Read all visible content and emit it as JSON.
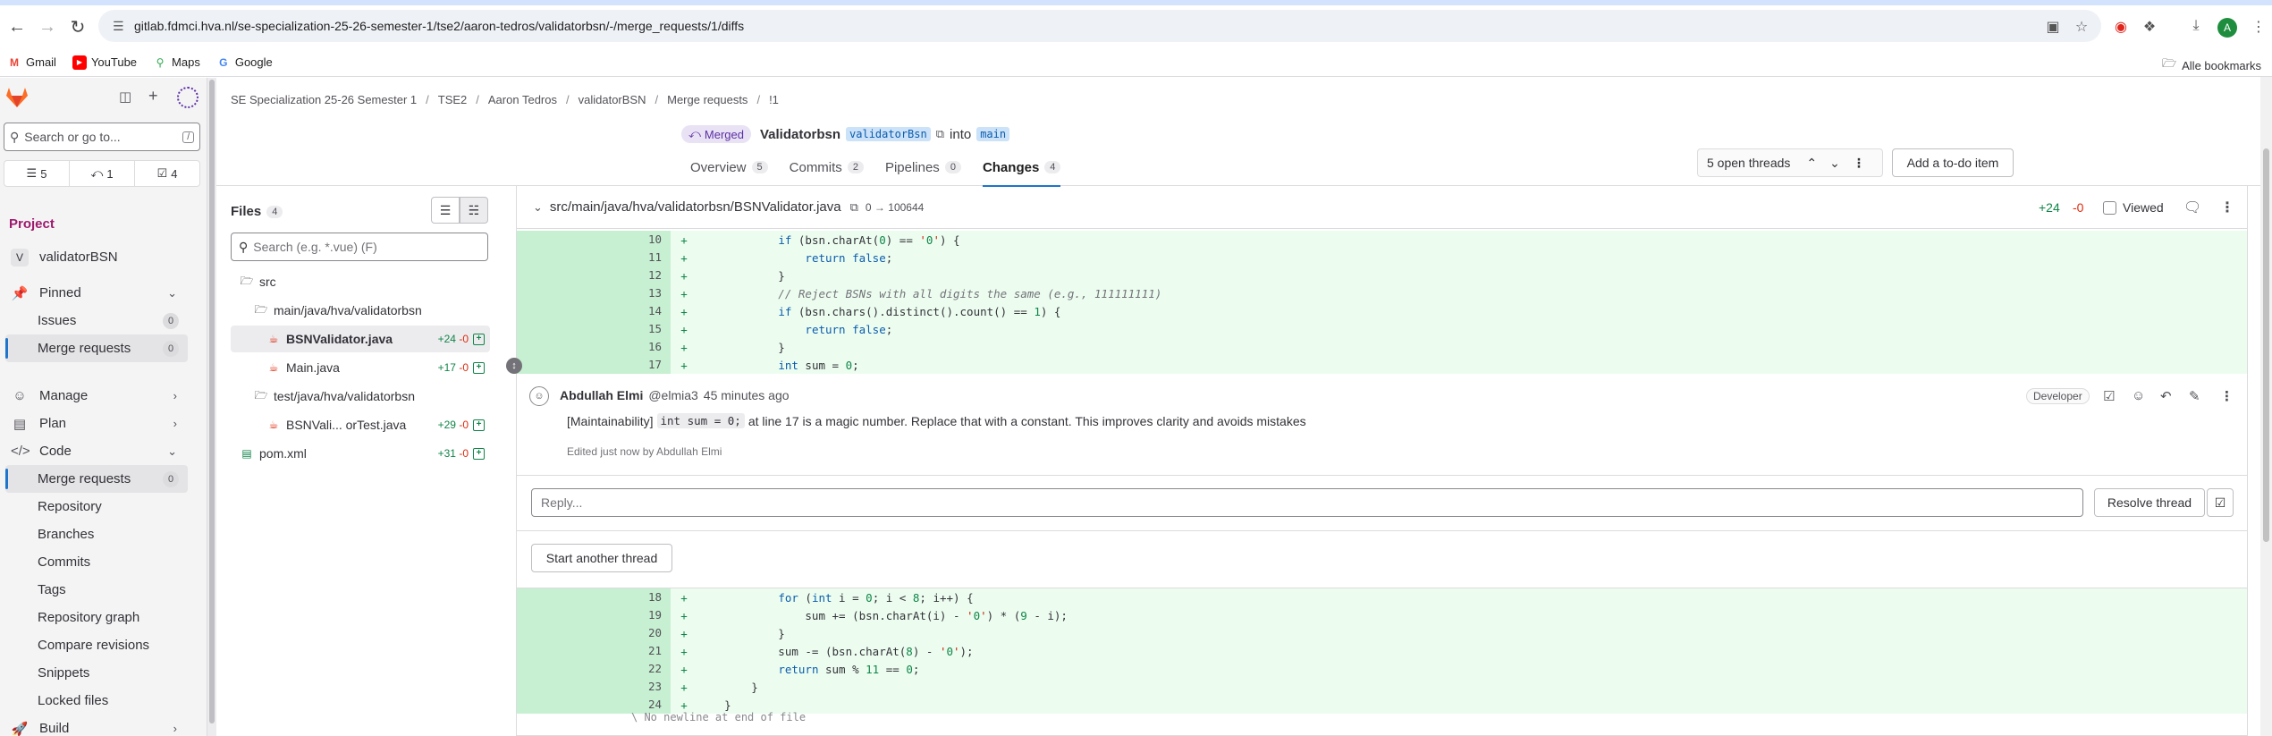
{
  "browser": {
    "url": "gitlab.fdmci.hva.nl/se-specialization-25-26-semester-1/tse2/aaron-tedros/validatorbsn/-/merge_requests/1/diffs",
    "bookmarks": [
      {
        "label": "Gmail",
        "icon": "gmail-icon"
      },
      {
        "label": "YouTube",
        "icon": "youtube-icon"
      },
      {
        "label": "Maps",
        "icon": "maps-icon"
      },
      {
        "label": "Google",
        "icon": "google-icon"
      }
    ],
    "all_bookmarks": "Alle bookmarks",
    "profile_initial": "A"
  },
  "sidebar": {
    "search_placeholder": "Search or go to...",
    "search_shortcut": "/",
    "counters": [
      {
        "icon": "issues-icon",
        "value": "5"
      },
      {
        "icon": "merge-request-icon",
        "value": "1"
      },
      {
        "icon": "todo-icon",
        "value": "4"
      }
    ],
    "context_label": "Project",
    "project_initial": "V",
    "project_name": "validatorBSN",
    "pinned_label": "Pinned",
    "pinned_items": [
      {
        "label": "Issues",
        "count": "0"
      },
      {
        "label": "Merge requests",
        "count": "0"
      }
    ],
    "sections": [
      {
        "label": "Manage",
        "icon": "users-icon"
      },
      {
        "label": "Plan",
        "icon": "planning-icon"
      },
      {
        "label": "Code",
        "icon": "code-icon"
      }
    ],
    "code_items": [
      {
        "label": "Merge requests",
        "count": "0"
      },
      {
        "label": "Repository"
      },
      {
        "label": "Branches"
      },
      {
        "label": "Commits"
      },
      {
        "label": "Tags"
      },
      {
        "label": "Repository graph"
      },
      {
        "label": "Compare revisions"
      },
      {
        "label": "Snippets"
      },
      {
        "label": "Locked files"
      }
    ],
    "build_label": "Build"
  },
  "breadcrumb": [
    "SE Specialization 25-26 Semester 1",
    "TSE2",
    "Aaron Tedros",
    "validatorBSN",
    "Merge requests",
    "!1"
  ],
  "mr": {
    "status": "Merged",
    "title": "Validatorbsn",
    "source_branch": "validatorBsn",
    "into": "into",
    "target_branch": "main",
    "tabs": [
      {
        "label": "Overview",
        "count": "5"
      },
      {
        "label": "Commits",
        "count": "2"
      },
      {
        "label": "Pipelines",
        "count": "0"
      },
      {
        "label": "Changes",
        "count": "4"
      }
    ],
    "open_threads": "5 open threads",
    "todo_button": "Add a to-do item"
  },
  "files": {
    "title": "Files",
    "count": "4",
    "search_placeholder": "Search (e.g. *.vue) (F)",
    "tree": [
      {
        "label": "src",
        "type": "folder",
        "indent": 1
      },
      {
        "label": "main/java/hva/validatorbsn",
        "type": "folder",
        "indent": 2
      },
      {
        "label": "BSNValidator.java",
        "type": "java",
        "indent": 3,
        "added": "+24",
        "removed": "-0",
        "active": true
      },
      {
        "label": "Main.java",
        "type": "java",
        "indent": 3,
        "added": "+17",
        "removed": "-0"
      },
      {
        "label": "test/java/hva/validatorbsn",
        "type": "folder",
        "indent": 2
      },
      {
        "label": "BSNVali... orTest.java",
        "type": "java",
        "indent": 3,
        "added": "+29",
        "removed": "-0"
      },
      {
        "label": "pom.xml",
        "type": "xml",
        "indent": 1,
        "added": "+31",
        "removed": "-0"
      }
    ]
  },
  "diff": {
    "file_path": "src/main/java/hva/validatorbsn/BSNValidator.java",
    "mode": "0 → 100644",
    "added": "+24",
    "removed": "-0",
    "viewed_label": "Viewed",
    "lines_top": [
      {
        "n": "10",
        "code": "            if (bsn.charAt(0) == '0') {"
      },
      {
        "n": "11",
        "code": "                return false;"
      },
      {
        "n": "12",
        "code": "            }"
      },
      {
        "n": "13",
        "code": "            // Reject BSNs with all digits the same (e.g., 111111111)"
      },
      {
        "n": "14",
        "code": "            if (bsn.chars().distinct().count() == 1) {"
      },
      {
        "n": "15",
        "code": "                return false;"
      },
      {
        "n": "16",
        "code": "            }"
      },
      {
        "n": "17",
        "code": "            int sum = 0;"
      }
    ],
    "lines_bottom": [
      {
        "n": "18",
        "code": "            for (int i = 0; i < 8; i++) {"
      },
      {
        "n": "19",
        "code": "                sum += (bsn.charAt(i) - '0') * (9 - i);"
      },
      {
        "n": "20",
        "code": "            }"
      },
      {
        "n": "21",
        "code": "            sum -= (bsn.charAt(8) - '0');"
      },
      {
        "n": "22",
        "code": "            return sum % 11 == 0;"
      },
      {
        "n": "23",
        "code": "        }"
      },
      {
        "n": "24",
        "code": "    }"
      }
    ],
    "no_newline": "\\ No newline at end of file"
  },
  "note": {
    "author": "Abdullah Elmi",
    "handle": "@elmia3",
    "time": "45 minutes ago",
    "role": "Developer",
    "tag": "[Maintainability]",
    "code": "int sum = 0;",
    "text": "at line 17 is a magic number. Replace that with a constant. This improves clarity and avoids mistakes",
    "edited": "Edited just now by Abdullah Elmi",
    "reply_placeholder": "Reply...",
    "resolve_label": "Resolve thread",
    "start_thread_label": "Start another thread"
  },
  "colors": {
    "accent": "#1f75cb",
    "added_bg": "#ecfdf0",
    "added_gutter": "#c7f0d2",
    "merged": "#5c2fa4",
    "green": "#108548",
    "red": "#dd2b0e"
  }
}
